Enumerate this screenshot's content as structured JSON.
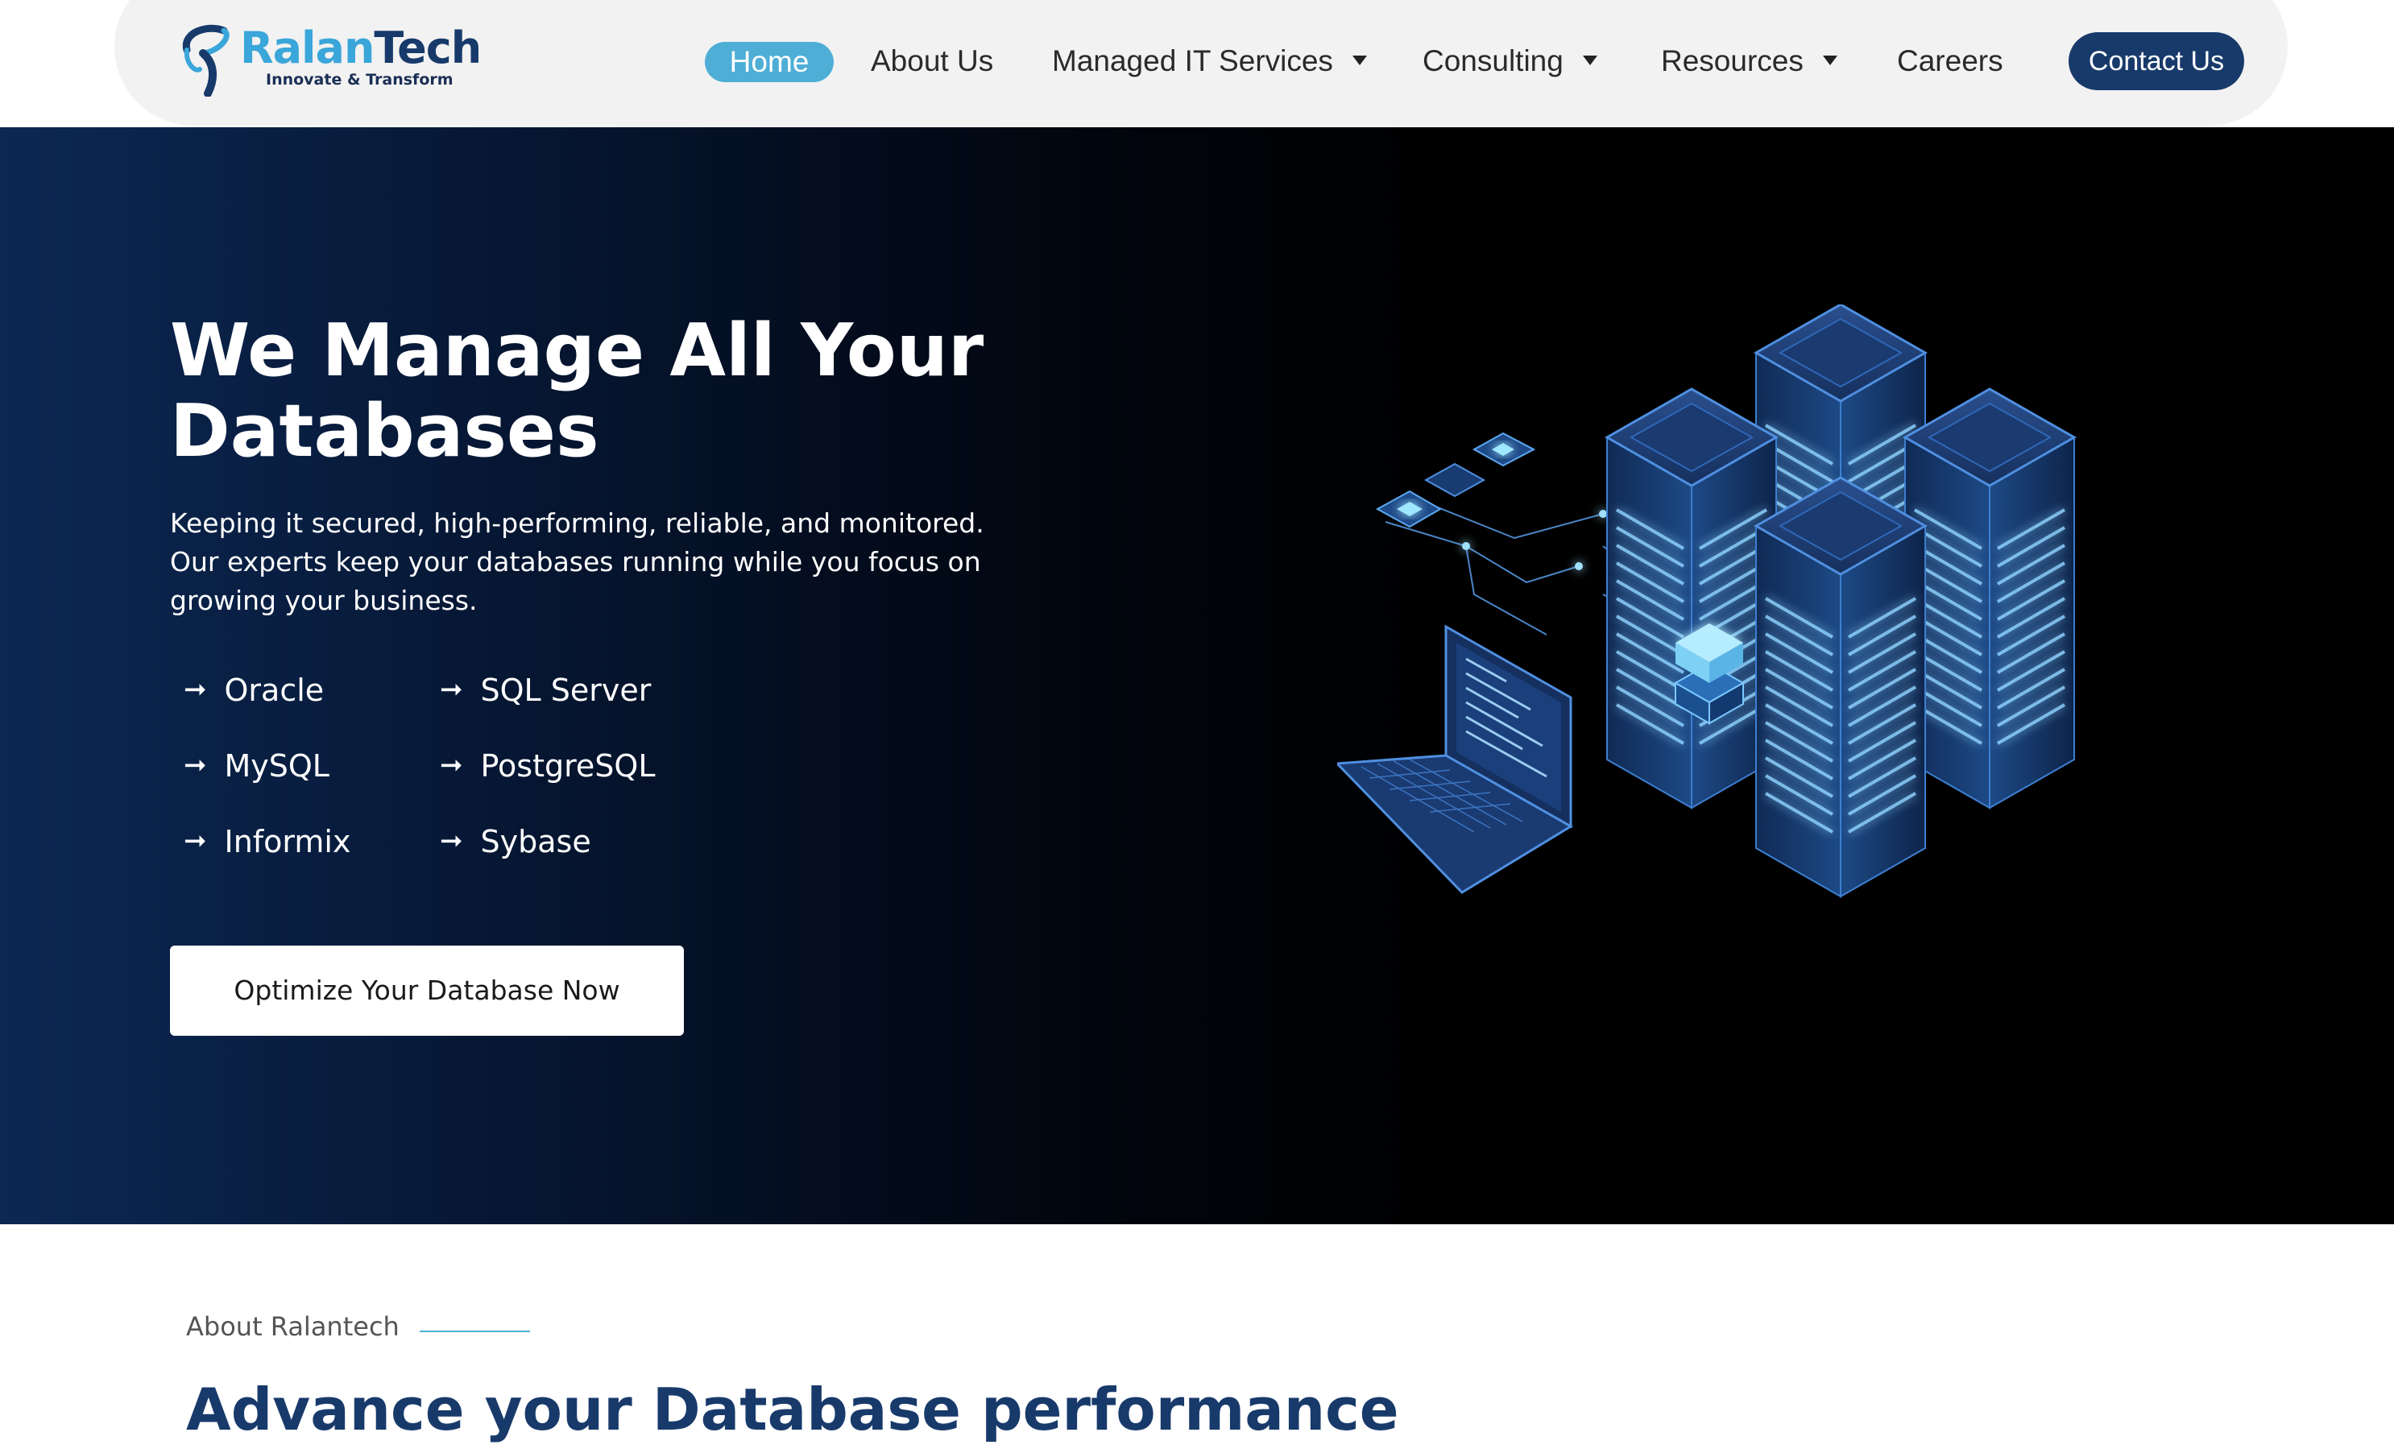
{
  "brand": {
    "name_part1": "Ralan",
    "name_part2": "Tech",
    "tagline": "Innovate & Transform",
    "colors": {
      "primary": "#183a6b",
      "accent": "#4eaed6"
    }
  },
  "nav": {
    "items": [
      {
        "label": "Home",
        "active": true,
        "dropdown": false
      },
      {
        "label": "About Us",
        "dropdown": false
      },
      {
        "label": "Managed IT Services",
        "dropdown": true
      },
      {
        "label": "Consulting",
        "dropdown": true
      },
      {
        "label": "Resources",
        "dropdown": true
      },
      {
        "label": "Careers",
        "dropdown": false
      }
    ],
    "contact_label": "Contact Us",
    "caret_icon": "caret-down-icon"
  },
  "hero": {
    "title": "We Manage All Your Databases",
    "subtitle": "Keeping it secured, high-performing, reliable, and monitored. Our experts keep your databases running while you focus on growing your business.",
    "bullet_icon": "arrow-right-icon",
    "databases": [
      "Oracle",
      "SQL Server",
      "MySQL",
      "PostgreSQL",
      "Informix",
      "Sybase"
    ],
    "cta_label": "Optimize Your Database Now",
    "illustration": "isometric-database-servers-laptop"
  },
  "about": {
    "label": "About Ralantech",
    "title": "Advance your Database performance"
  }
}
